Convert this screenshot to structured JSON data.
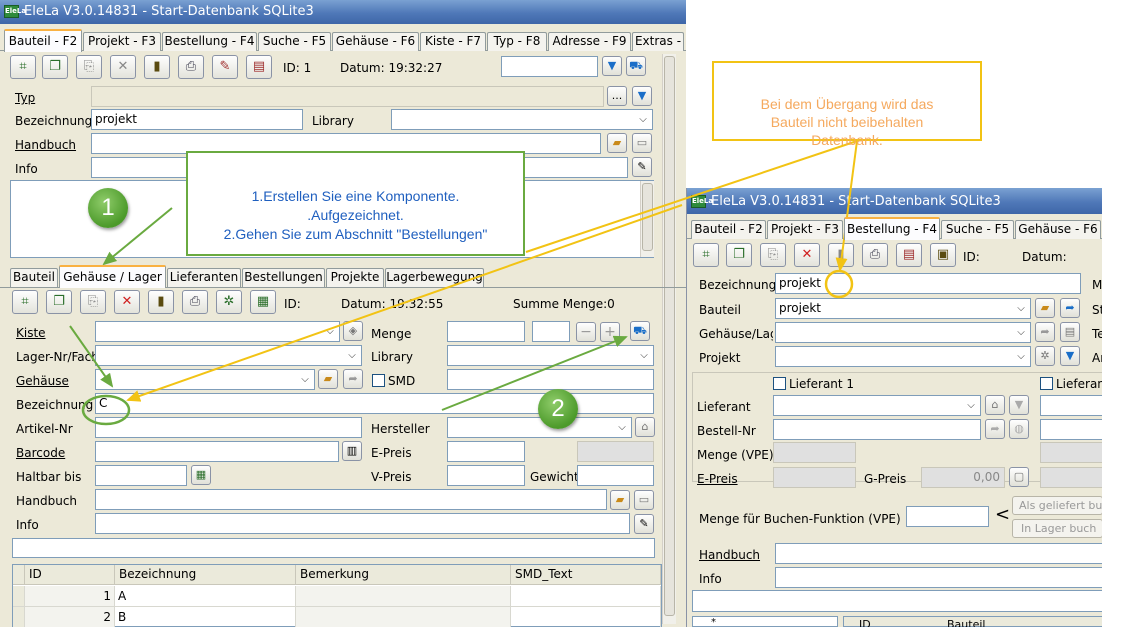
{
  "main_window": {
    "title": "EleLa V3.0.14831  - Start-Datenbank SQLite3",
    "icon_text": "EleLa",
    "tabs": [
      "Bauteil - F2",
      "Projekt - F3",
      "Bestellung - F4",
      "Suche - F5",
      "Gehäuse - F6",
      "Kiste - F7",
      "Typ - F8",
      "Adresse - F9",
      "Extras -"
    ],
    "toolbar": {
      "id_label": "ID: 1",
      "datum_label": "Datum: 19:32:27"
    },
    "form": {
      "typ_label": "Typ",
      "bezeichnung_label": "Bezeichnung",
      "bezeichnung_value": "projekt",
      "library_label": "Library",
      "handbuch_label": "Handbuch",
      "info_label": "Info",
      "dots_button": "..."
    },
    "subtabs": [
      "Bauteil",
      "Gehäuse / Lager",
      "Lieferanten",
      "Bestellungen",
      "Projekte",
      "Lagerbewegung"
    ],
    "subtoolbar": {
      "id_label": "ID:",
      "datum_label": "Datum: 19:32:55",
      "summe_label": "Summe Menge:0"
    },
    "lager_form": {
      "kiste_label": "Kiste",
      "menge_label": "Menge",
      "lagernr_label": "Lager-Nr/Fach",
      "library_label": "Library",
      "gehaeuse_label": "Gehäuse",
      "smd_label": "SMD",
      "bezeichnung_label": "Bezeichnung",
      "bezeichnung_value": "C",
      "artikelnr_label": "Artikel-Nr",
      "hersteller_label": "Hersteller",
      "barcode_label": "Barcode",
      "epreis_label": "E-Preis",
      "haltbar_label": "Haltbar bis",
      "vpreis_label": "V-Preis",
      "gewicht_label": "Gewicht",
      "handbuch_label": "Handbuch",
      "info_label": "Info"
    },
    "grid": {
      "columns": [
        "ID",
        "Bezeichnung",
        "Bemerkung",
        "SMD_Text"
      ],
      "rows": [
        {
          "id": "1",
          "bezeichnung": "A"
        },
        {
          "id": "2",
          "bezeichnung": "B"
        }
      ]
    }
  },
  "second_window": {
    "title": "EleLa V3.0.14831  - Start-Datenbank SQLite3",
    "icon_text": "EleLa",
    "tabs": [
      "Bauteil - F2",
      "Projekt - F3",
      "Bestellung - F4",
      "Suche - F5",
      "Gehäuse - F6"
    ],
    "toolbar": {
      "id_label": "ID:",
      "datum_label": "Datum:"
    },
    "form": {
      "bezeichnung_label": "Bezeichnung",
      "bezeichnung_value": "projekt",
      "m_label": "M",
      "bauteil_label": "Bauteil",
      "bauteil_value": "projekt",
      "s_label": "St",
      "gehaeuse_label": "Gehäuse/Lager",
      "t_label": "Te",
      "projekt_label": "Projekt",
      "a_label": "Ar",
      "lieferant1_label": "Lieferant 1",
      "lieferant2_label": "Lieferan",
      "lieferant_label": "Lieferant",
      "bestellnr_label": "Bestell-Nr",
      "menge_vpe_label": "Menge (VPE)",
      "epreis_label": "E-Preis",
      "gpreis_label": "G-Preis",
      "gpreis_value": "0,00",
      "buchen_label": "Menge für Buchen-Funktion (VPE)",
      "less_than": "<",
      "geliefert_button": "Als geliefert buc",
      "inlager_button": "In Lager buch",
      "handbuch_label": "Handbuch",
      "info_label": "Info",
      "grid_star": "*",
      "grid_id": "ID",
      "grid_bauteil": "Bauteil"
    }
  },
  "annotations": {
    "note1": "1.Erstellen Sie eine Komponente.\n.Aufgezeichnet.\n2.Gehen Sie zum Abschnitt \"Bestellungen\"",
    "note2": "Bei dem Übergang wird das\nBauteil nicht beibehalten\nDatenbank.",
    "step1": "1",
    "step2": "2"
  },
  "colors": {
    "annotation_green": "#6aaa40",
    "annotation_yellow": "#f2c314",
    "note2_text": "#f5a95e",
    "note1_text": "#1f5fbf",
    "title_blue": "#3e66a8"
  }
}
